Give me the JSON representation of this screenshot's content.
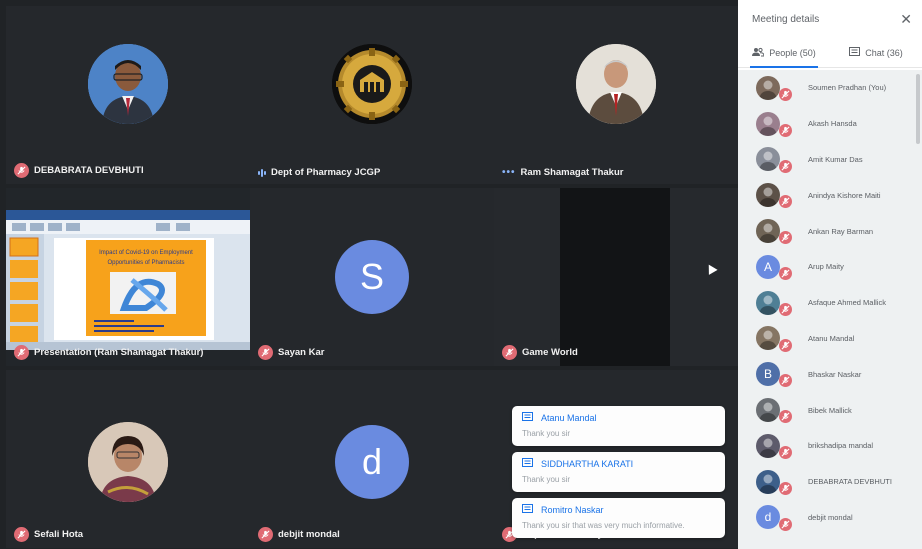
{
  "colors": {
    "mic_off": "#e06b74",
    "accent": "#1a73e8",
    "letter_blue": "#6a8be0",
    "letter_slate": "#4f6fa8"
  },
  "tiles": [
    {
      "name": "DEBABRATA DEVBHUTI",
      "status": "muted"
    },
    {
      "name": "Dept of Pharmacy JCGP",
      "status": "speaking"
    },
    {
      "name": "Ram Shamagat Thakur",
      "status": "more"
    },
    {
      "name": "Presentation (Ram Shamagat Thakur)",
      "status": "muted"
    },
    {
      "name": "Sayan Kar",
      "status": "muted",
      "avatar_letter": "S"
    },
    {
      "name": "Game World",
      "status": "muted"
    },
    {
      "name": "Sefali Hota",
      "status": "muted"
    },
    {
      "name": "debjit mondal",
      "status": "muted",
      "avatar_letter": "d"
    },
    {
      "name": "Dept of Pharmacy JCGP",
      "status": "muted"
    }
  ],
  "presentation": {
    "slide_title": "Impact of Covid-19 on Employment Opportunities of Pharmacists"
  },
  "toasts": [
    {
      "sender": "Atanu Mandal",
      "message": "Thank you sir"
    },
    {
      "sender": "SIDDHARTHA KARATI",
      "message": "Thank you sir"
    },
    {
      "sender": "Romitro Naskar",
      "message": "Thank you sir that was very much informative."
    }
  ],
  "panel": {
    "title": "Meeting details",
    "close_icon": "close-icon",
    "tabs": [
      {
        "label": "People (50)",
        "icon": "people-icon",
        "active": true
      },
      {
        "label": "Chat (36)",
        "icon": "chat-icon",
        "active": false
      }
    ],
    "people": [
      {
        "name": "Soumen Pradhan (You)",
        "avatar": "photo",
        "color": "#7d6a5c"
      },
      {
        "name": "Akash Hansda",
        "avatar": "photo",
        "color": "#9a7f8e"
      },
      {
        "name": "Amit Kumar Das",
        "avatar": "photo",
        "color": "#8a8f9a"
      },
      {
        "name": "Anindya Kishore Maiti",
        "avatar": "photo",
        "color": "#5c5148"
      },
      {
        "name": "Ankan Ray Barman",
        "avatar": "photo",
        "color": "#6f6456"
      },
      {
        "name": "Arup Maity",
        "avatar": "letter",
        "letter": "A",
        "color": "#6a8be0"
      },
      {
        "name": "Asfaque Ahmed Mallick",
        "avatar": "photo",
        "color": "#4f7f95"
      },
      {
        "name": "Atanu Mandal",
        "avatar": "photo",
        "color": "#857563"
      },
      {
        "name": "Bhaskar Naskar",
        "avatar": "letter",
        "letter": "B",
        "color": "#4f6fa8"
      },
      {
        "name": "Bibek Mallick",
        "avatar": "photo",
        "color": "#6b6f74"
      },
      {
        "name": "brikshadipa mandal",
        "avatar": "photo",
        "color": "#5d5b6b"
      },
      {
        "name": "DEBABRATA DEVBHUTI",
        "avatar": "photo",
        "color": "#3d5f8a"
      },
      {
        "name": "debjit mondal",
        "avatar": "letter",
        "letter": "d",
        "color": "#6a8be0"
      }
    ]
  }
}
